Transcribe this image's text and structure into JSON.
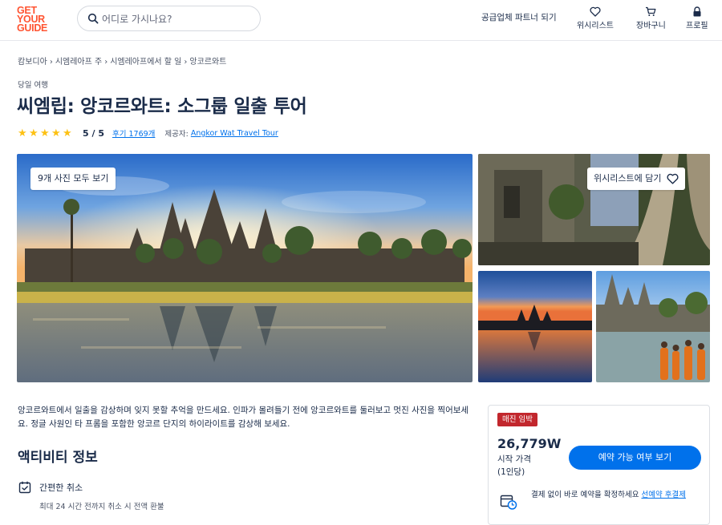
{
  "header": {
    "logo": [
      "GET",
      "YOUR",
      "GUIDE"
    ],
    "search_placeholder": "어디로 가시나요?",
    "supplier_link": "공급업체 파트너 되기",
    "wishlist_label": "위시리스트",
    "cart_label": "장바구니",
    "profile_label": "프로필"
  },
  "breadcrumb": [
    "캄보디아",
    "시엠레아프 주",
    "시엠레아프에서 할 일",
    "앙코르와트"
  ],
  "activity": {
    "kicker": "당일 여행",
    "title": "씨엠립: 앙코르와트: 소그룹 일출 투어",
    "rating_value": 5,
    "rating_text": "5 / 5",
    "reviews_link": "후기 1769개",
    "provider_label": "제공자:",
    "provider_name": "Angkor Wat Travel Tour"
  },
  "gallery": {
    "all_photos_button": "9개 사진 모두 보기",
    "wishlist_button": "위시리스트에 담기"
  },
  "description": "앙코르와트에서 일출을 감상하며 잊지 못할 추억을 만드세요. 인파가 몰려들기 전에 앙코르와트를 둘러보고 멋진 사진을 찍어보세요. 정글 사원인 타 프롬을 포함한 앙코르 단지의 하이라이트를 감상해 보세요.",
  "info": {
    "section_title": "액티비티 정보",
    "cancellation_title": "간편한 취소",
    "cancellation_sub": "최대 24 시간 전까지 취소 시 전액 환불"
  },
  "booking": {
    "badge": "매진 임박",
    "price": "26,779W",
    "price_note_1": "시작 가격",
    "price_note_2": "(1인당)",
    "check_button": "예약 가능 여부 보기",
    "reserve_text": "결제 없이 바로 예약을 확정하세요 ",
    "reserve_link": "선예약 후결제"
  },
  "colors": {
    "brand": "#ff5533",
    "primary_blue": "#0071eb",
    "badge_red": "#c2272d",
    "star_yellow": "#fdc114",
    "text_dark": "#1a2b49"
  }
}
